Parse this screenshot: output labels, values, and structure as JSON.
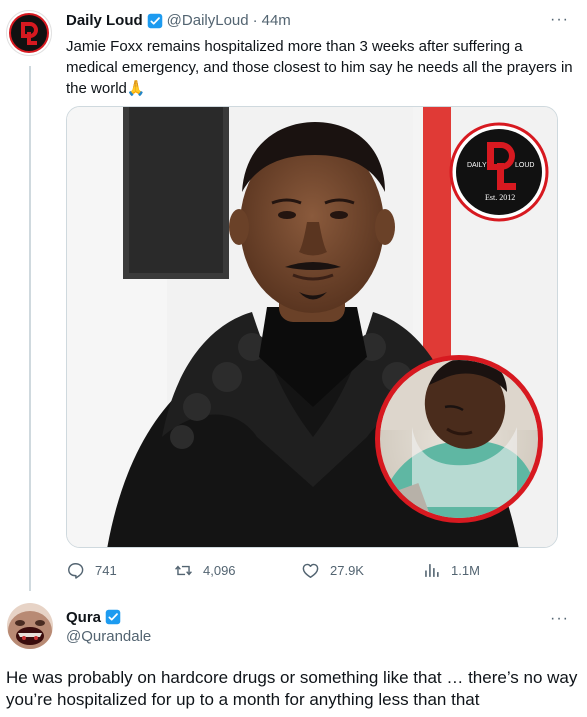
{
  "tweet": {
    "author_name": "Daily Loud",
    "handle": "@DailyLoud",
    "separator": "·",
    "time": "44m",
    "more_label": "···",
    "text": "Jamie Foxx remains hospitalized more than 3 weeks after suffering a medical emergency, and those closest to him say he needs all the prayers in the world🙏",
    "logo": {
      "daily": "DAILY",
      "loud": "LOUD",
      "est": "Est. 2012",
      "mark": "DL"
    },
    "stats": {
      "replies": "741",
      "retweets": "4,096",
      "likes": "27.9K",
      "views": "1.1M"
    }
  },
  "reply": {
    "author_name": "Qura",
    "handle": "@Qurandale",
    "more_label": "···",
    "text": "He was probably on hardcore drugs or something like that … there’s no way you’re hospitalized for up to a month for anything less than that"
  },
  "colors": {
    "verified": "#1d9bf0",
    "text_secondary": "#536471",
    "brand_red": "#d71920"
  }
}
